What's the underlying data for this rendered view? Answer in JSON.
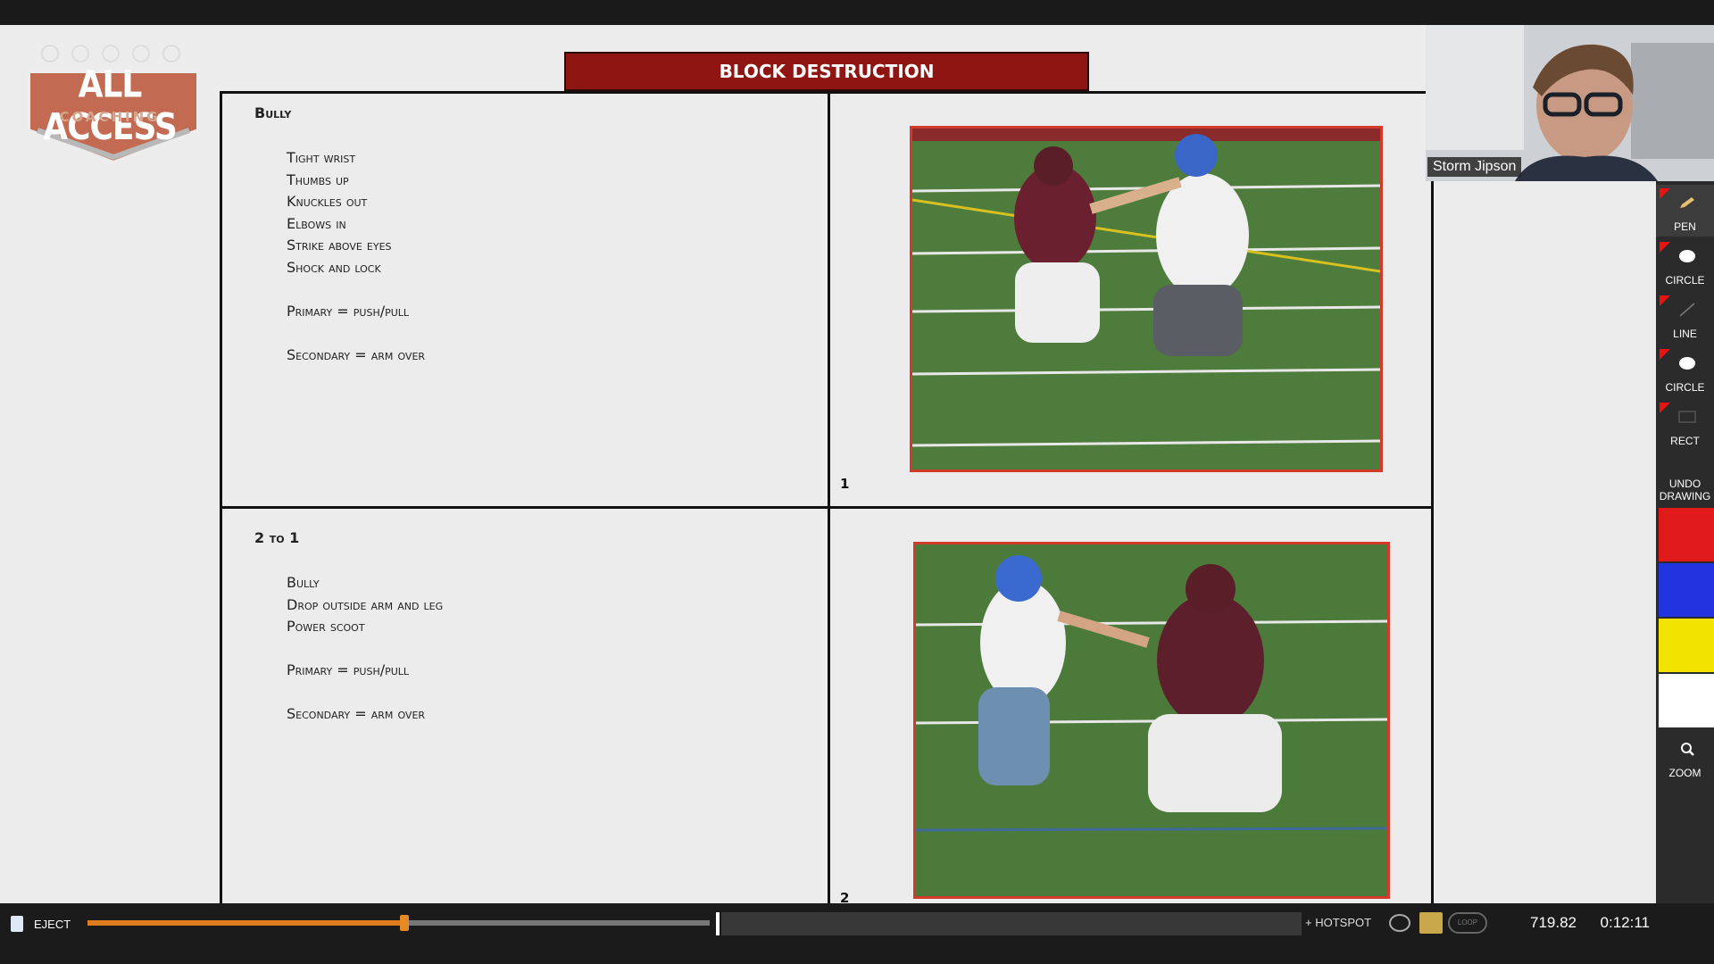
{
  "logo": {
    "line1": "ALL ACCESS",
    "line2": "COACHING"
  },
  "slide": {
    "title": "BLOCK DESTRUCTION",
    "cell1": {
      "heading": "Bully",
      "lines": [
        "Tight wrist",
        "Thumbs up",
        "Knuckles out",
        "Elbows in",
        "Strike above eyes",
        "Shock and lock",
        "",
        "Primary = push/pull",
        "",
        "Secondary = arm over"
      ]
    },
    "cell2": {
      "heading": "2 to 1",
      "lines": [
        "Bully",
        "Drop outside arm and leg",
        "Power scoot",
        "",
        "Primary = push/pull",
        "",
        "Secondary = arm over"
      ]
    },
    "photo1_number": "1",
    "photo2_number": "2"
  },
  "webcam": {
    "name": "Storm Jipson"
  },
  "toolbar": {
    "tools": [
      {
        "label": "PEN",
        "icon": "pencil-icon"
      },
      {
        "label": "CIRCLE",
        "icon": "filled-circle-icon"
      },
      {
        "label": "LINE",
        "icon": "line-icon"
      },
      {
        "label": "CIRCLE",
        "icon": "outline-circle-icon"
      },
      {
        "label": "RECT",
        "icon": "rectangle-icon"
      }
    ],
    "undo_label": "UNDO DRAWING",
    "colors": [
      "#e01a1a",
      "#2234e0",
      "#f2e400",
      "#ffffff"
    ],
    "zoom_label": "ZOOM"
  },
  "bottombar": {
    "eject_label": "EJECT",
    "progress": 0.51,
    "hotspot_label": "+ HOTSPOT",
    "loop_label": "LOOP",
    "time_value": "719.82",
    "clock": "0:12:11"
  }
}
